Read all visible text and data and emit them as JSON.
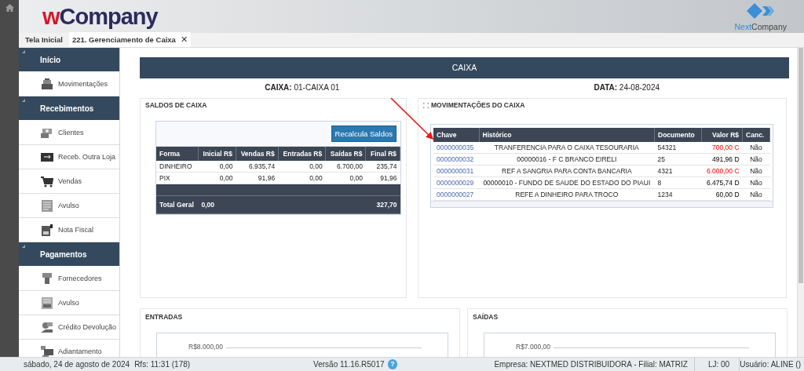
{
  "header": {
    "logo": {
      "accent": "w",
      "rest": "Company"
    },
    "partner_logo": {
      "accent": "Next",
      "rest": "Company"
    }
  },
  "tabs": [
    {
      "label": "Tela Inicial",
      "selected": false
    },
    {
      "label": "221. Gerenciamento de Caixa",
      "selected": true,
      "close_label": "✕"
    }
  ],
  "sidebar": {
    "sections": [
      {
        "label": "Início",
        "items": [
          {
            "label": "Movimentações"
          }
        ]
      },
      {
        "label": "Recebimentos",
        "items": [
          {
            "label": "Clientes"
          },
          {
            "label": "Receb. Outra Loja"
          },
          {
            "label": "Vendas"
          },
          {
            "label": "Avulso"
          },
          {
            "label": "Nota Fiscal"
          }
        ]
      },
      {
        "label": "Pagamentos",
        "items": [
          {
            "label": "Fornecedores"
          },
          {
            "label": "Avulso"
          },
          {
            "label": "Crédito Devolução"
          },
          {
            "label": "Adiantamento"
          }
        ]
      }
    ]
  },
  "banner": {
    "title": "CAIXA"
  },
  "info": [
    {
      "label": "CAIXA:",
      "value": "01-CAIXA 01"
    },
    {
      "label": "DATA:",
      "value": "24-08-2024"
    }
  ],
  "saldos": {
    "title": "SALDOS DE CAIXA",
    "button": "Recalcula Saldos",
    "columns": [
      "Forma",
      "Inicial R$",
      "Vendas R$",
      "Entradas R$",
      "Saídas R$",
      "Final R$"
    ],
    "rows": [
      [
        "DINHEIRO",
        "0,00",
        "6.935,74",
        "0,00",
        "6.700,00",
        "235,74"
      ],
      [
        "PIX",
        "0,00",
        "91,96",
        "0,00",
        "0,00",
        "91,96"
      ]
    ],
    "total": {
      "label": "Total Geral",
      "inicial": "0,00",
      "final": "327,70"
    }
  },
  "movimentacoes": {
    "title": "MOVIMENTAÇÕES DO CAIXA",
    "columns": [
      "Chave",
      "Histórico",
      "Documento",
      "Valor R$",
      "Canc."
    ],
    "rows": [
      {
        "chave": "0000000035",
        "historico": "TRANFERENCIA PARA O CAIXA TESOURARIA",
        "documento": "54321",
        "valor": "700,00 C",
        "kind": "credit",
        "canc": "Não"
      },
      {
        "chave": "0000000032",
        "historico": "00000016 - F C BRANCO EIRELI",
        "documento": "25",
        "valor": "491,96 D",
        "kind": "debit",
        "canc": "Não"
      },
      {
        "chave": "0000000031",
        "historico": "REF A SANGRIA PARA CONTA BANCARIA",
        "documento": "4321",
        "valor": "6.000,00 C",
        "kind": "credit",
        "canc": "Não"
      },
      {
        "chave": "0000000029",
        "historico": "00000010 - FUNDO DE SAUDE DO ESTADO DO PIAUI",
        "documento": "8",
        "valor": "6.475,74 D",
        "kind": "debit",
        "canc": "Não"
      },
      {
        "chave": "0000000027",
        "historico": "REFE A DINHEIRO PARA TROCO",
        "documento": "1234",
        "valor": "60,00 D",
        "kind": "debit",
        "canc": "Não"
      }
    ]
  },
  "charts": [
    {
      "title": "ENTRADAS",
      "tick_label": "R$8.000,00"
    },
    {
      "title": "SAÍDAS",
      "tick_label": "R$7.000,00"
    }
  ],
  "status_bar": {
    "date": "sábado, 24 de agosto de 2024",
    "refresh": "Rfs: 11:31 (178)",
    "version": "Versão 11.16.R5017",
    "help": "?",
    "company": "Empresa: NEXTMED DISTRIBUIDORA - Filial: MATRIZ",
    "store": "LJ: 00",
    "user": "Usuário: ALINE ()"
  }
}
